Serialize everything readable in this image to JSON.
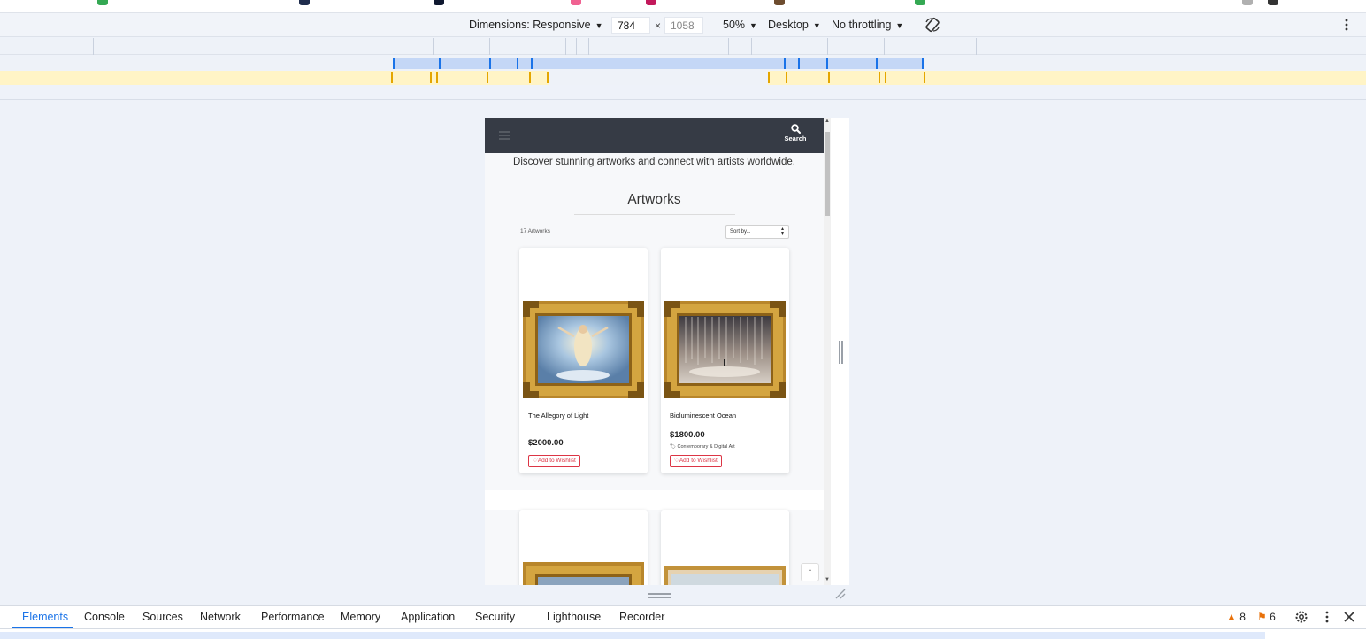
{
  "device_toolbar": {
    "dimensions_label": "Dimensions: Responsive",
    "width": "784",
    "times": "×",
    "height": "1058",
    "zoom": "50%",
    "device_type": "Desktop",
    "throttling": "No throttling"
  },
  "page": {
    "search_label": "Search",
    "tagline": "Discover stunning artworks and connect with artists worldwide.",
    "section_title": "Artworks",
    "count_label": "17 Artworks",
    "sort_placeholder": "Sort by...",
    "artworks": [
      {
        "title": "The Allegory of Light",
        "price": "$2000.00",
        "category": "",
        "wishlist_label": "Add to Wishlist"
      },
      {
        "title": "Bioluminescent Ocean",
        "price": "$1800.00",
        "category": "Contemporary & Digital Art",
        "wishlist_label": "Add to Wishlist"
      }
    ]
  },
  "devtools": {
    "tabs": [
      "Elements",
      "Console",
      "Sources",
      "Network",
      "Performance",
      "Memory",
      "Application",
      "Security",
      "Lighthouse",
      "Recorder"
    ],
    "warnings_count": "8",
    "issues_count": "6"
  },
  "colors": {
    "navbar_bg": "#363b45",
    "accent_blue": "#1a73e8",
    "wishlist_red": "#dc3545"
  }
}
